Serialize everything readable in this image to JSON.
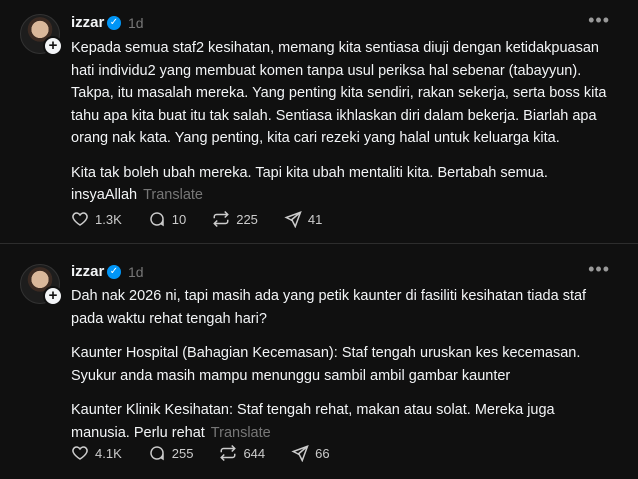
{
  "posts": [
    {
      "username": "izzar",
      "time": "1d",
      "paragraphs": [
        "Kepada semua staf2 kesihatan, memang kita sentiasa diuji dengan ketidakpuasan hati individu2 yang membuat komen tanpa usul periksa hal sebenar (tabayyun). Takpa, itu masalah mereka. Yang penting kita sendiri, rakan sekerja, serta boss kita tahu apa kita buat itu tak salah. Sentiasa ikhlaskan diri dalam bekerja. Biarlah apa orang nak kata. Yang penting, kita cari rezeki yang halal untuk keluarga kita.",
        "Kita tak boleh ubah mereka. Tapi kita ubah mentaliti kita. Bertabah semua. insyaAllah"
      ],
      "translate": "Translate",
      "likes": "1.3K",
      "comments": "10",
      "reposts": "225",
      "shares": "41"
    },
    {
      "username": "izzar",
      "time": "1d",
      "paragraphs": [
        "Dah nak 2026 ni, tapi masih ada yang petik kaunter di fasiliti kesihatan tiada staf pada waktu rehat tengah hari?",
        "Kaunter Hospital (Bahagian Kecemasan): Staf tengah uruskan kes kecemasan. Syukur anda masih mampu menunggu sambil ambil gambar kaunter",
        "Kaunter Klinik Kesihatan: Staf tengah rehat, makan atau solat. Mereka juga manusia. Perlu rehat"
      ],
      "translate": "Translate",
      "likes": "4.1K",
      "comments": "255",
      "reposts": "644",
      "shares": "66"
    }
  ]
}
